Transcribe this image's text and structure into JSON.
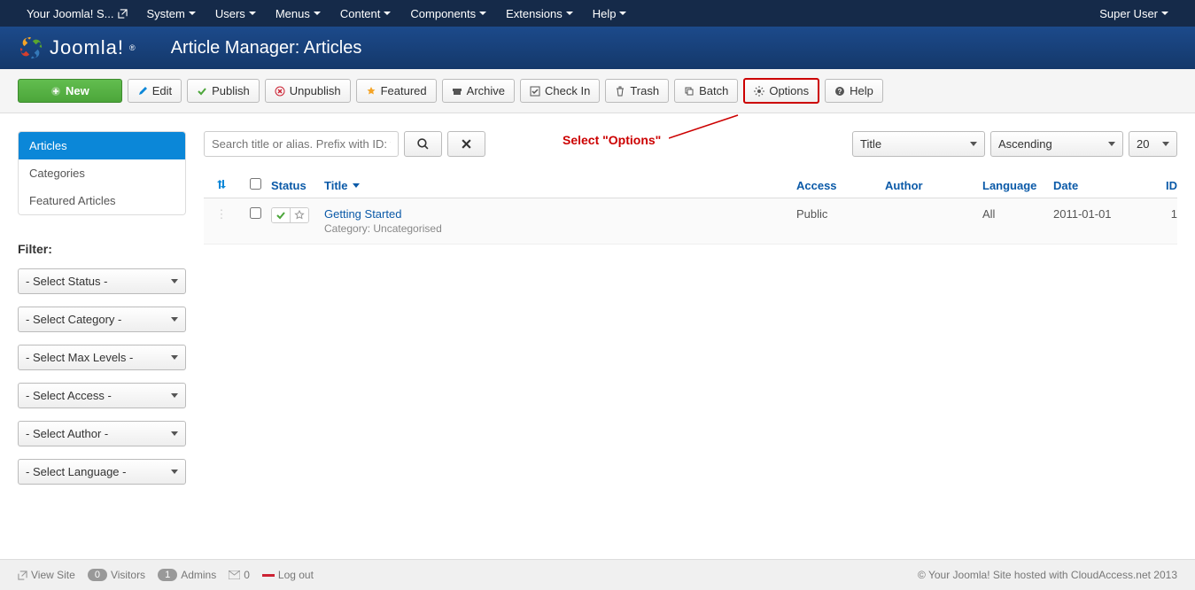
{
  "topnav": {
    "site_name": "Your Joomla! S...",
    "menus": [
      "System",
      "Users",
      "Menus",
      "Content",
      "Components",
      "Extensions",
      "Help"
    ],
    "user": "Super User"
  },
  "header": {
    "brand": "Joomla!",
    "title": "Article Manager: Articles"
  },
  "toolbar": {
    "new": "New",
    "edit": "Edit",
    "publish": "Publish",
    "unpublish": "Unpublish",
    "featured": "Featured",
    "archive": "Archive",
    "checkin": "Check In",
    "trash": "Trash",
    "batch": "Batch",
    "options": "Options",
    "help": "Help"
  },
  "annotation": "Select \"Options\"",
  "sidebar": {
    "items": [
      "Articles",
      "Categories",
      "Featured Articles"
    ],
    "filter_label": "Filter:",
    "filters": [
      "- Select Status -",
      "- Select Category -",
      "- Select Max Levels -",
      "- Select Access -",
      "- Select Author -",
      "- Select Language -"
    ]
  },
  "search": {
    "placeholder": "Search title or alias. Prefix with ID: t"
  },
  "sort": {
    "field": "Title",
    "direction": "Ascending",
    "limit": "20"
  },
  "columns": {
    "status": "Status",
    "title": "Title",
    "access": "Access",
    "author": "Author",
    "language": "Language",
    "date": "Date",
    "id": "ID"
  },
  "rows": [
    {
      "title": "Getting Started",
      "category": "Category: Uncategorised",
      "access": "Public",
      "author": "",
      "language": "All",
      "date": "2011-01-01",
      "id": "1"
    }
  ],
  "footer": {
    "view_site": "View Site",
    "visitors_count": "0",
    "visitors": "Visitors",
    "admins_count": "1",
    "admins": "Admins",
    "msgs": "0",
    "logout": "Log out",
    "copyright": "© Your Joomla! Site hosted with CloudAccess.net 2013"
  }
}
